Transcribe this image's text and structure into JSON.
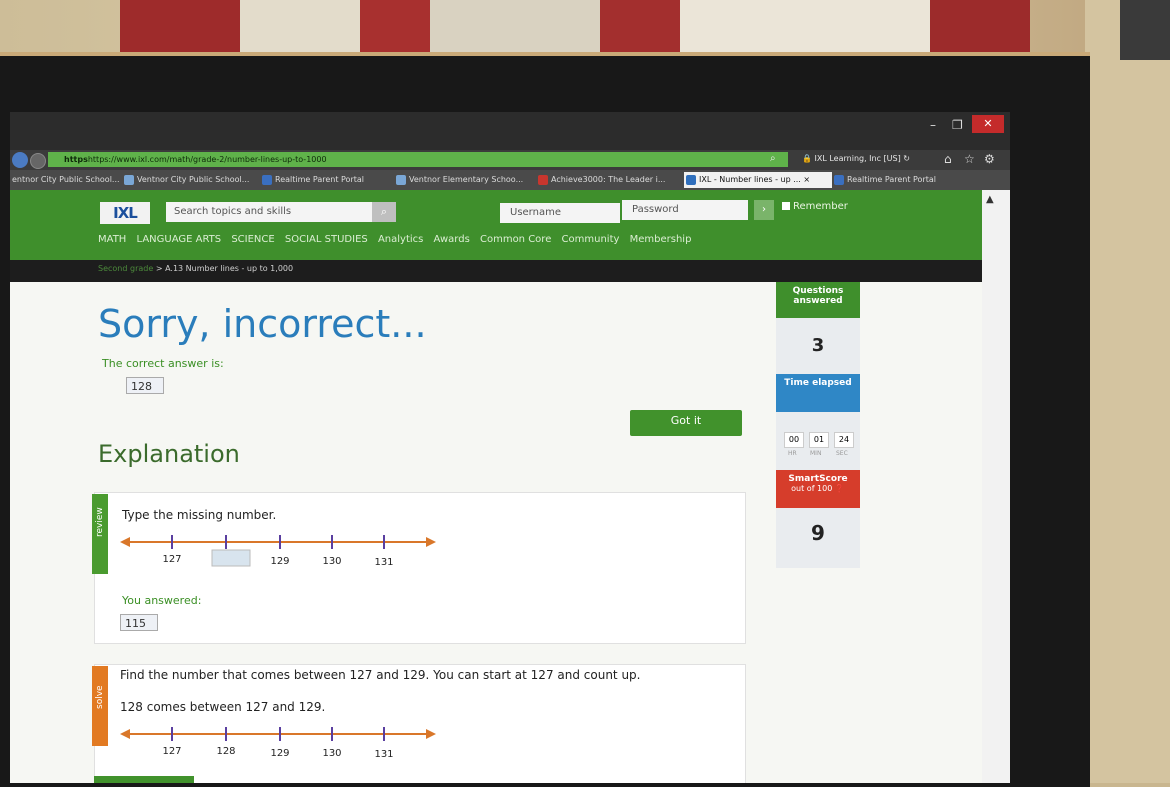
{
  "browser": {
    "url": "https://www.ixl.com/math/grade-2/number-lines-up-to-1000",
    "url_scheme": "https",
    "site_identity": "IXL Learning, Inc [US]",
    "tabs": [
      {
        "label": "entnor City Public School..."
      },
      {
        "label": "Ventnor City Public School..."
      },
      {
        "label": "Realtime Parent Portal"
      },
      {
        "label": "Ventnor Elementary Schoo..."
      },
      {
        "label": "Achieve3000: The Leader i..."
      },
      {
        "label": "IXL - Number lines - up ... ×",
        "active": true
      },
      {
        "label": "Realtime Parent Portal"
      }
    ]
  },
  "header": {
    "logo": "IXL",
    "search_placeholder": "Search topics and skills",
    "username_placeholder": "Username",
    "password_placeholder": "Password",
    "remember_label": "Remember",
    "nav": [
      "MATH",
      "LANGUAGE ARTS",
      "SCIENCE",
      "SOCIAL STUDIES",
      "Analytics",
      "Awards",
      "Common Core",
      "Community",
      "Membership"
    ]
  },
  "breadcrumb": {
    "grade": "Second grade",
    "separator": ">",
    "skill": "A.13 Number lines - up to 1,000"
  },
  "result": {
    "title": "Sorry, incorrect...",
    "correct_label": "The correct answer is:",
    "correct_value": "128",
    "got_it_label": "Got it",
    "explanation_heading": "Explanation"
  },
  "review": {
    "ribbon": "review",
    "question": "Type the missing number.",
    "ticks": [
      "127",
      "",
      "129",
      "130",
      "131"
    ],
    "you_answered_label": "You answered:",
    "you_answered_value": "115"
  },
  "solve": {
    "ribbon": "solve",
    "text1": "Find the number that comes between 127 and 129. You can start at 127 and count up.",
    "text2": "128 comes between 127 and 129.",
    "ticks": [
      "127",
      "128",
      "129",
      "130",
      "131"
    ]
  },
  "stats": {
    "questions_label": "Questions answered",
    "questions_value": "3",
    "time_label": "Time elapsed",
    "time_hr": "00",
    "time_min": "01",
    "time_sec": "24",
    "hr_label": "HR",
    "min_label": "MIN",
    "sec_label": "SEC",
    "smartscore_label": "SmartScore",
    "smartscore_sub": "out of 100",
    "smartscore_value": "9"
  },
  "colors": {
    "ixl_green": "#3f8f2c",
    "title_blue": "#2a7dbb",
    "score_red": "#d63d2b",
    "arrow_orange": "#d9772a",
    "tick_purple": "#5a3fa0"
  }
}
